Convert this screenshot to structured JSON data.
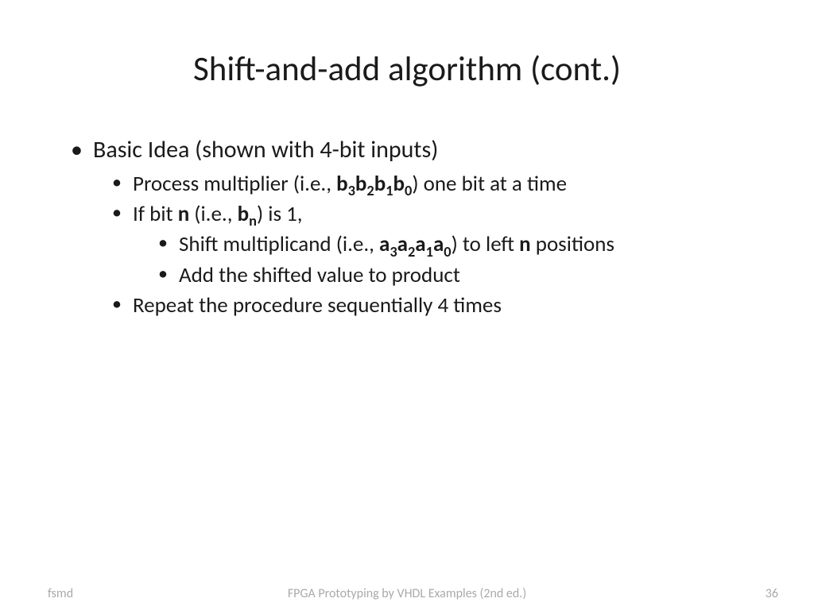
{
  "title": "Shift-and-add algorithm (cont.)",
  "body": {
    "l1": "Basic Idea (shown with 4-bit inputs)",
    "l2a_pre": "Process multiplier (i.e., ",
    "l2a_b3": "b",
    "l2a_s3": "3",
    "l2a_b2": "b",
    "l2a_s2": "2",
    "l2a_b1": "b",
    "l2a_s1": "1",
    "l2a_b0": "b",
    "l2a_s0": "0",
    "l2a_post": ") one bit at a time",
    "l2b_pre": "If bit ",
    "l2b_n": "n",
    "l2b_mid": " (i.e., ",
    "l2b_bn_b": "b",
    "l2b_bn_n": "n",
    "l2b_post": ") is 1,",
    "l3a_pre": "Shift multiplicand (i.e., ",
    "l3a_a3": "a",
    "l3a_s3": "3",
    "l3a_a2": "a",
    "l3a_s2": "2",
    "l3a_a1": "a",
    "l3a_s1": "1",
    "l3a_a0": "a",
    "l3a_s0": "0",
    "l3a_mid": ") to left ",
    "l3a_n": "n",
    "l3a_post": " positions",
    "l3b": "Add the shifted value to product",
    "l2c": "Repeat the procedure sequentially 4 times"
  },
  "footer": {
    "left": "fsmd",
    "center": "FPGA Prototyping by VHDL Examples (2nd ed.)",
    "right": "36"
  }
}
